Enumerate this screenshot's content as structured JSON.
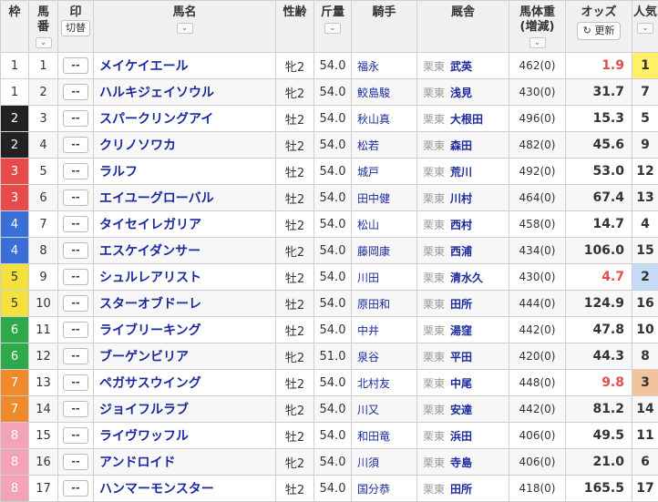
{
  "header": {
    "waku": "枠",
    "umaban_l1": "馬",
    "umaban_l2": "番",
    "mark_l1": "印",
    "mark_btn": "切替",
    "name": "馬名",
    "sexage": "性齢",
    "kinryo": "斤量",
    "jockey": "騎手",
    "stable": "厩舎",
    "bw_l1": "馬体重",
    "bw_l2": "(増減)",
    "odds": "オッズ",
    "refresh": "更新",
    "pop": "人気"
  },
  "colors": {
    "waku": {
      "1": "#ffffff",
      "2": "#222222",
      "3": "#e84a4a",
      "4": "#3a6fd8",
      "5": "#f5e13b",
      "6": "#2fa84b",
      "7": "#f08a2b",
      "8": "#f3a3b7"
    },
    "pop_1": "#fff06a",
    "pop_2": "#c6daf6",
    "pop_3": "#f2c49d"
  },
  "rows": [
    {
      "waku": "1",
      "num": "1",
      "mark": "--",
      "name": "メイケイエール",
      "sexage": "牝2",
      "kinryo": "54.0",
      "jockey": "福永",
      "area": "栗東",
      "trainer": "武英",
      "bw": "462(0)",
      "odds": "1.9",
      "pop": "1"
    },
    {
      "waku": "1",
      "num": "2",
      "mark": "--",
      "name": "ハルキジェイソウル",
      "sexage": "牝2",
      "kinryo": "54.0",
      "jockey": "鮫島駿",
      "area": "栗東",
      "trainer": "浅見",
      "bw": "430(0)",
      "odds": "31.7",
      "pop": "7"
    },
    {
      "waku": "2",
      "num": "3",
      "mark": "--",
      "name": "スパークリングアイ",
      "sexage": "牡2",
      "kinryo": "54.0",
      "jockey": "秋山真",
      "area": "栗東",
      "trainer": "大根田",
      "bw": "496(0)",
      "odds": "15.3",
      "pop": "5"
    },
    {
      "waku": "2",
      "num": "4",
      "mark": "--",
      "name": "クリノソワカ",
      "sexage": "牡2",
      "kinryo": "54.0",
      "jockey": "松若",
      "area": "栗東",
      "trainer": "森田",
      "bw": "482(0)",
      "odds": "45.6",
      "pop": "9"
    },
    {
      "waku": "3",
      "num": "5",
      "mark": "--",
      "name": "ラルフ",
      "sexage": "牡2",
      "kinryo": "54.0",
      "jockey": "城戸",
      "area": "栗東",
      "trainer": "荒川",
      "bw": "492(0)",
      "odds": "53.0",
      "pop": "12"
    },
    {
      "waku": "3",
      "num": "6",
      "mark": "--",
      "name": "エイユーグローバル",
      "sexage": "牡2",
      "kinryo": "54.0",
      "jockey": "田中健",
      "area": "栗東",
      "trainer": "川村",
      "bw": "464(0)",
      "odds": "67.4",
      "pop": "13"
    },
    {
      "waku": "4",
      "num": "7",
      "mark": "--",
      "name": "タイセイレガリア",
      "sexage": "牡2",
      "kinryo": "54.0",
      "jockey": "松山",
      "area": "栗東",
      "trainer": "西村",
      "bw": "458(0)",
      "odds": "14.7",
      "pop": "4"
    },
    {
      "waku": "4",
      "num": "8",
      "mark": "--",
      "name": "エスケイダンサー",
      "sexage": "牝2",
      "kinryo": "54.0",
      "jockey": "藤岡康",
      "area": "栗東",
      "trainer": "西浦",
      "bw": "434(0)",
      "odds": "106.0",
      "pop": "15"
    },
    {
      "waku": "5",
      "num": "9",
      "mark": "--",
      "name": "シュルレアリスト",
      "sexage": "牡2",
      "kinryo": "54.0",
      "jockey": "川田",
      "area": "栗東",
      "trainer": "清水久",
      "bw": "430(0)",
      "odds": "4.7",
      "pop": "2"
    },
    {
      "waku": "5",
      "num": "10",
      "mark": "--",
      "name": "スターオブドーレ",
      "sexage": "牡2",
      "kinryo": "54.0",
      "jockey": "原田和",
      "area": "栗東",
      "trainer": "田所",
      "bw": "444(0)",
      "odds": "124.9",
      "pop": "16"
    },
    {
      "waku": "6",
      "num": "11",
      "mark": "--",
      "name": "ライブリーキング",
      "sexage": "牡2",
      "kinryo": "54.0",
      "jockey": "中井",
      "area": "栗東",
      "trainer": "湯窪",
      "bw": "442(0)",
      "odds": "47.8",
      "pop": "10"
    },
    {
      "waku": "6",
      "num": "12",
      "mark": "--",
      "name": "ブーゲンビリア",
      "sexage": "牝2",
      "kinryo": "51.0",
      "jockey": "泉谷",
      "area": "栗東",
      "trainer": "平田",
      "bw": "420(0)",
      "odds": "44.3",
      "pop": "8"
    },
    {
      "waku": "7",
      "num": "13",
      "mark": "--",
      "name": "ペガサスウイング",
      "sexage": "牡2",
      "kinryo": "54.0",
      "jockey": "北村友",
      "area": "栗東",
      "trainer": "中尾",
      "bw": "448(0)",
      "odds": "9.8",
      "pop": "3"
    },
    {
      "waku": "7",
      "num": "14",
      "mark": "--",
      "name": "ジョイフルラブ",
      "sexage": "牝2",
      "kinryo": "54.0",
      "jockey": "川又",
      "area": "栗東",
      "trainer": "安達",
      "bw": "442(0)",
      "odds": "81.2",
      "pop": "14"
    },
    {
      "waku": "8",
      "num": "15",
      "mark": "--",
      "name": "ライヴワッフル",
      "sexage": "牡2",
      "kinryo": "54.0",
      "jockey": "和田竜",
      "area": "栗東",
      "trainer": "浜田",
      "bw": "406(0)",
      "odds": "49.5",
      "pop": "11"
    },
    {
      "waku": "8",
      "num": "16",
      "mark": "--",
      "name": "アンドロイド",
      "sexage": "牝2",
      "kinryo": "54.0",
      "jockey": "川須",
      "area": "栗東",
      "trainer": "寺島",
      "bw": "406(0)",
      "odds": "21.0",
      "pop": "6"
    },
    {
      "waku": "8",
      "num": "17",
      "mark": "--",
      "name": "ハンマーモンスター",
      "sexage": "牡2",
      "kinryo": "54.0",
      "jockey": "国分恭",
      "area": "栗東",
      "trainer": "田所",
      "bw": "418(0)",
      "odds": "165.5",
      "pop": "17"
    }
  ]
}
